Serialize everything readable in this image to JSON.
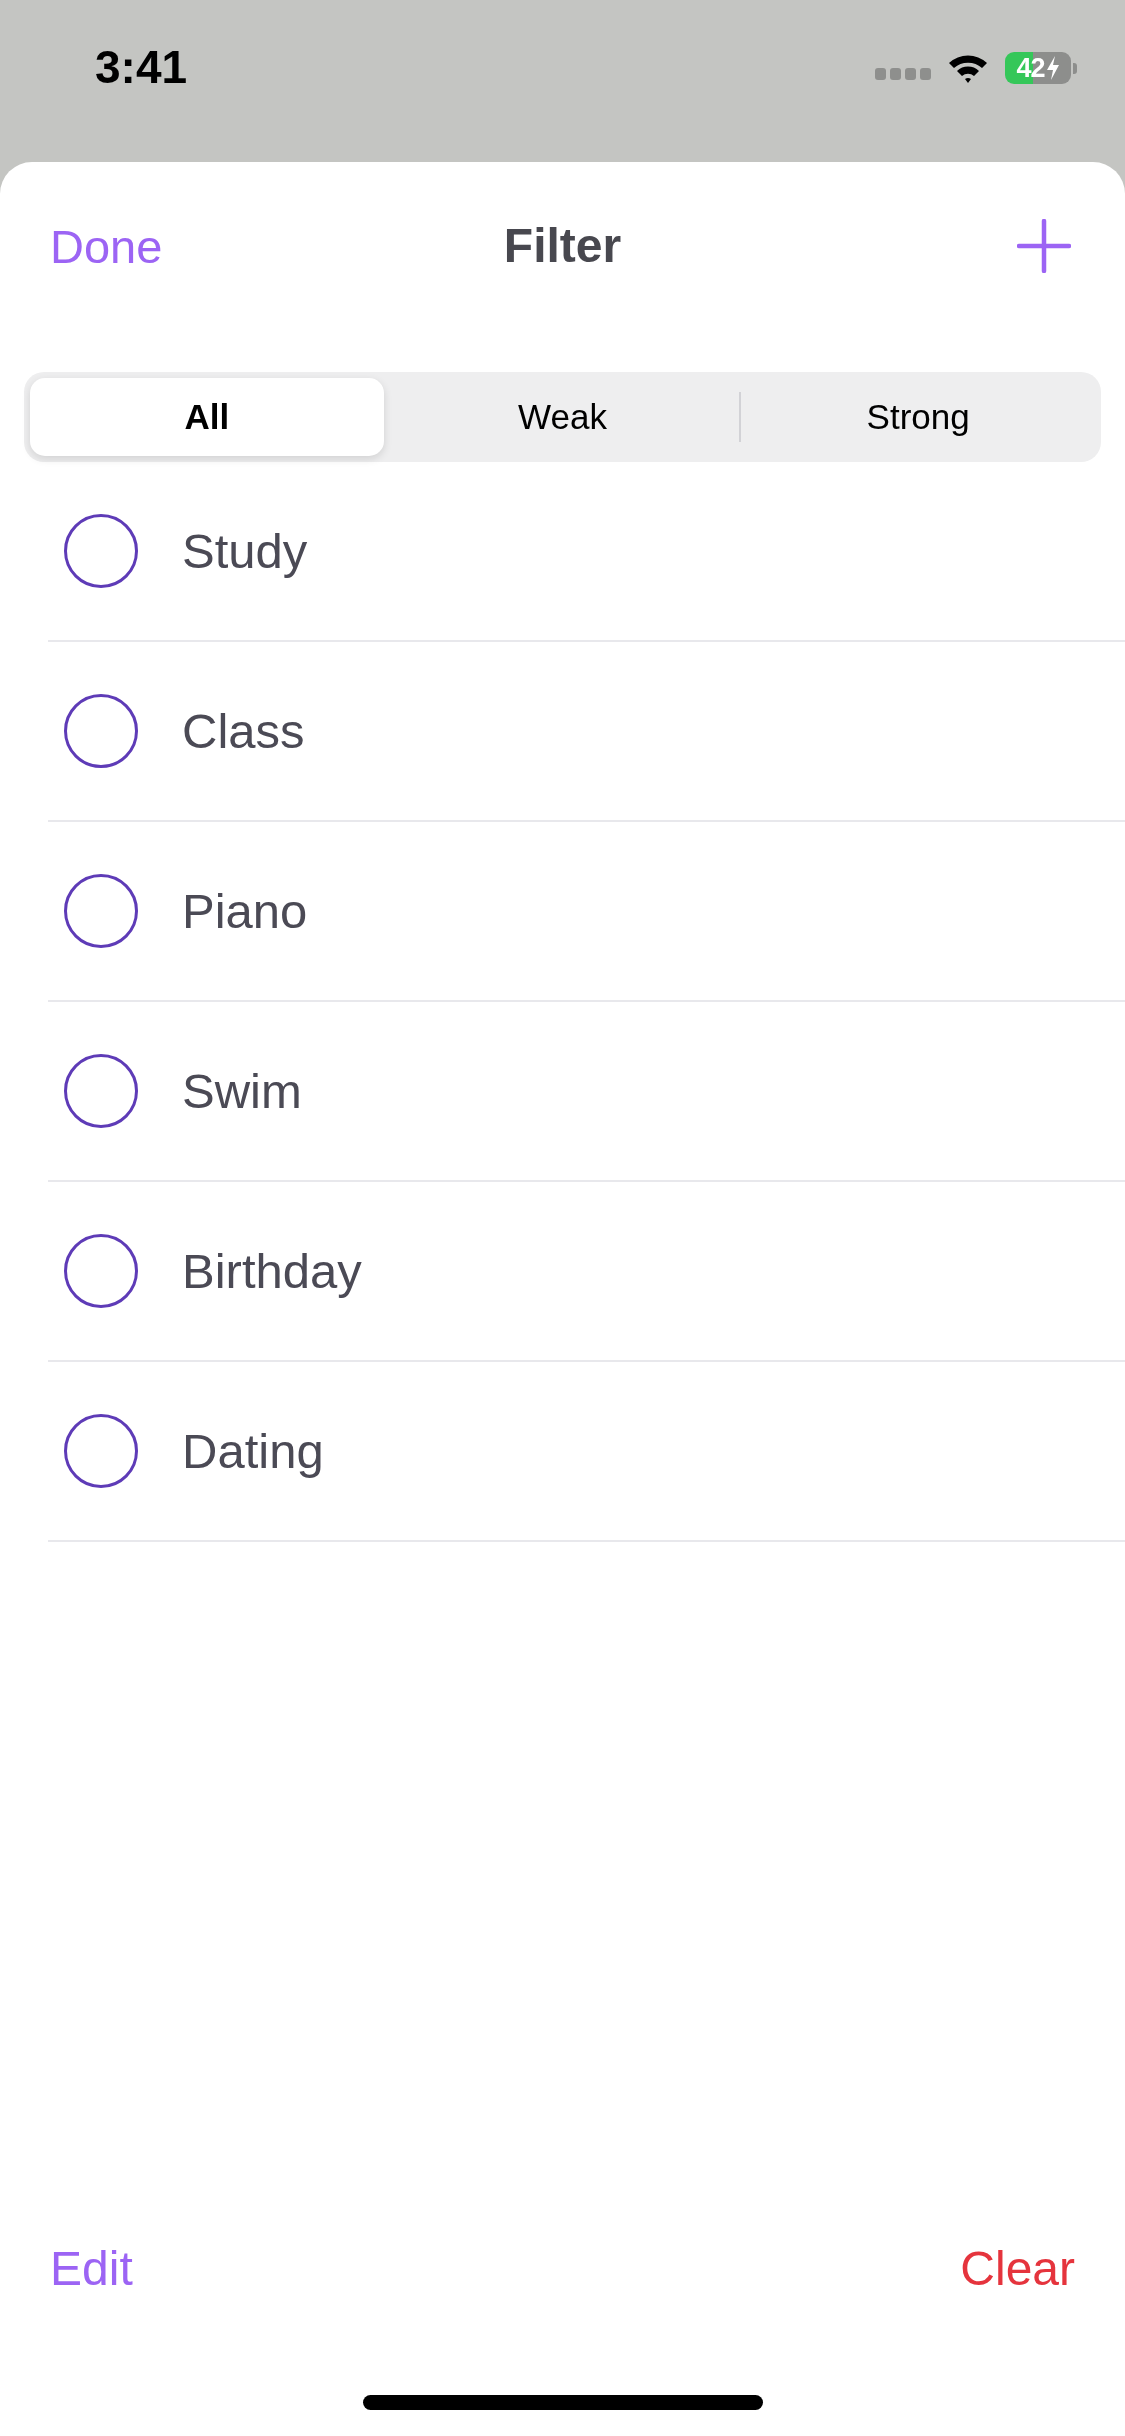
{
  "status_bar": {
    "time": "3:41",
    "battery": "42"
  },
  "header": {
    "done_button": "Done",
    "title": "Filter"
  },
  "segments": [
    {
      "label": "All",
      "selected": true
    },
    {
      "label": "Weak",
      "selected": false
    },
    {
      "label": "Strong",
      "selected": false
    }
  ],
  "items": [
    {
      "label": "Study",
      "checked": false
    },
    {
      "label": "Class",
      "checked": false
    },
    {
      "label": "Piano",
      "checked": false
    },
    {
      "label": "Swim",
      "checked": false
    },
    {
      "label": "Birthday",
      "checked": false
    },
    {
      "label": "Dating",
      "checked": false
    }
  ],
  "footer": {
    "edit_button": "Edit",
    "clear_button": "Clear"
  }
}
